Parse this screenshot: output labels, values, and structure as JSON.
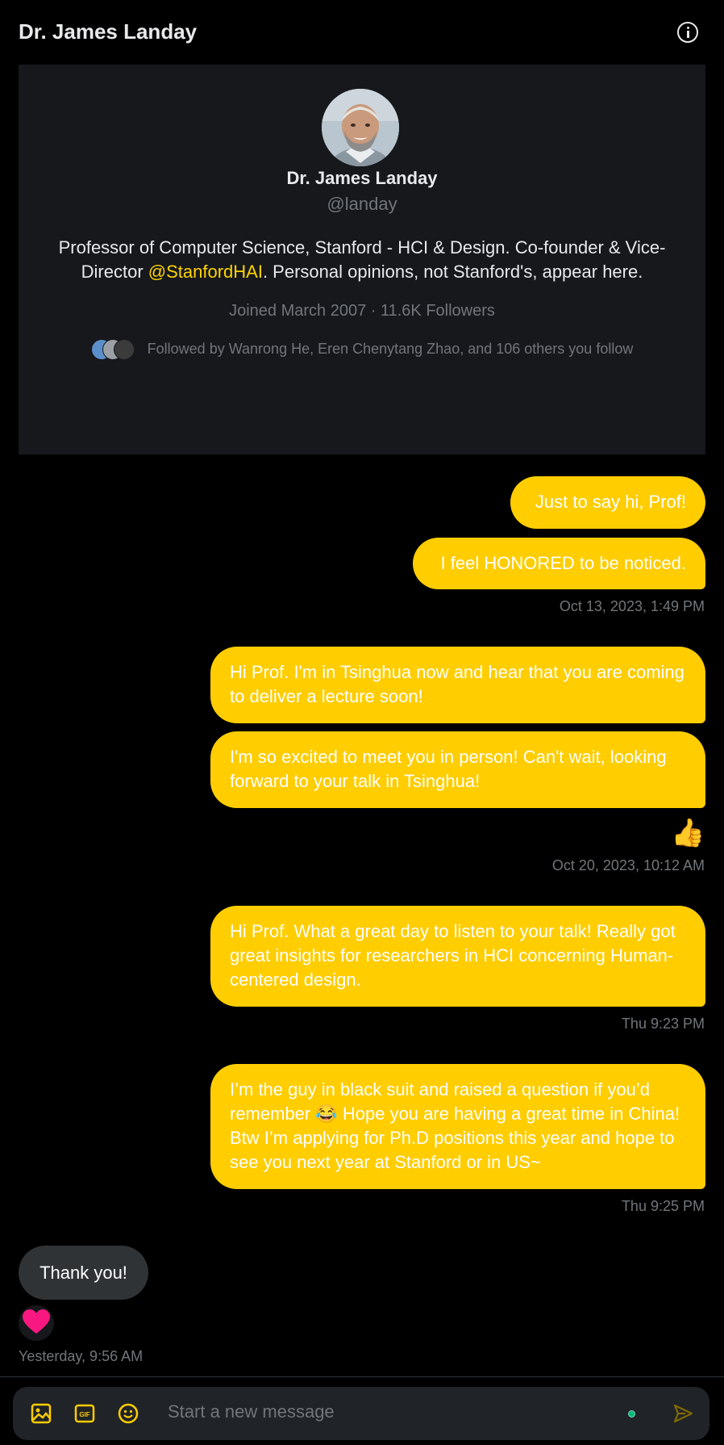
{
  "header": {
    "title": "Dr. James Landay"
  },
  "profile": {
    "name": "Dr. James Landay",
    "handle": "@landay",
    "bio_before": "Professor of Computer Science, Stanford - HCI & Design. Co-founder & Vice-Director ",
    "bio_mention": "@StanfordHAI",
    "bio_after": ". Personal opinions, not Stanford's, appear here.",
    "joined": "Joined March 2007 · 11.6K Followers",
    "followed_by": "Followed by Wanrong He, Eren Chenytang Zhao, and 106 others you follow"
  },
  "messages": [
    {
      "text": "Just to say hi, Prof!"
    },
    {
      "text": "I feel HONORED to be noticed."
    },
    {
      "text": "Hi Prof. I'm in Tsinghua now and hear that you are coming to deliver a lecture soon!"
    },
    {
      "text": "I'm so excited to meet you in person! Can't wait, looking forward to your talk in Tsinghua!"
    },
    {
      "text": "Hi Prof. What a great day to listen to your talk! Really got great insights for researchers in HCI concerning Human-centered design."
    },
    {
      "text": "I’m the guy in black suit and raised a question if you’d remember 😂 Hope you are having a great time in China! Btw I’m applying for Ph.D positions this year and hope to see you next year at Stanford or in US~"
    }
  ],
  "incoming": {
    "text": "Thank you!"
  },
  "reactions": {
    "thumbs": "👍"
  },
  "timestamps": {
    "t1": "Oct 13, 2023, 1:49 PM",
    "t2": "Oct 20, 2023, 10:12 AM",
    "t3": "Thu 9:23 PM",
    "t4": "Thu 9:25 PM",
    "t5": "Yesterday, 9:56 AM"
  },
  "composer": {
    "placeholder": "Start a new message"
  },
  "colors": {
    "accent": "#ffcd00",
    "heart": "#f91880",
    "online": "#00ba7c"
  }
}
